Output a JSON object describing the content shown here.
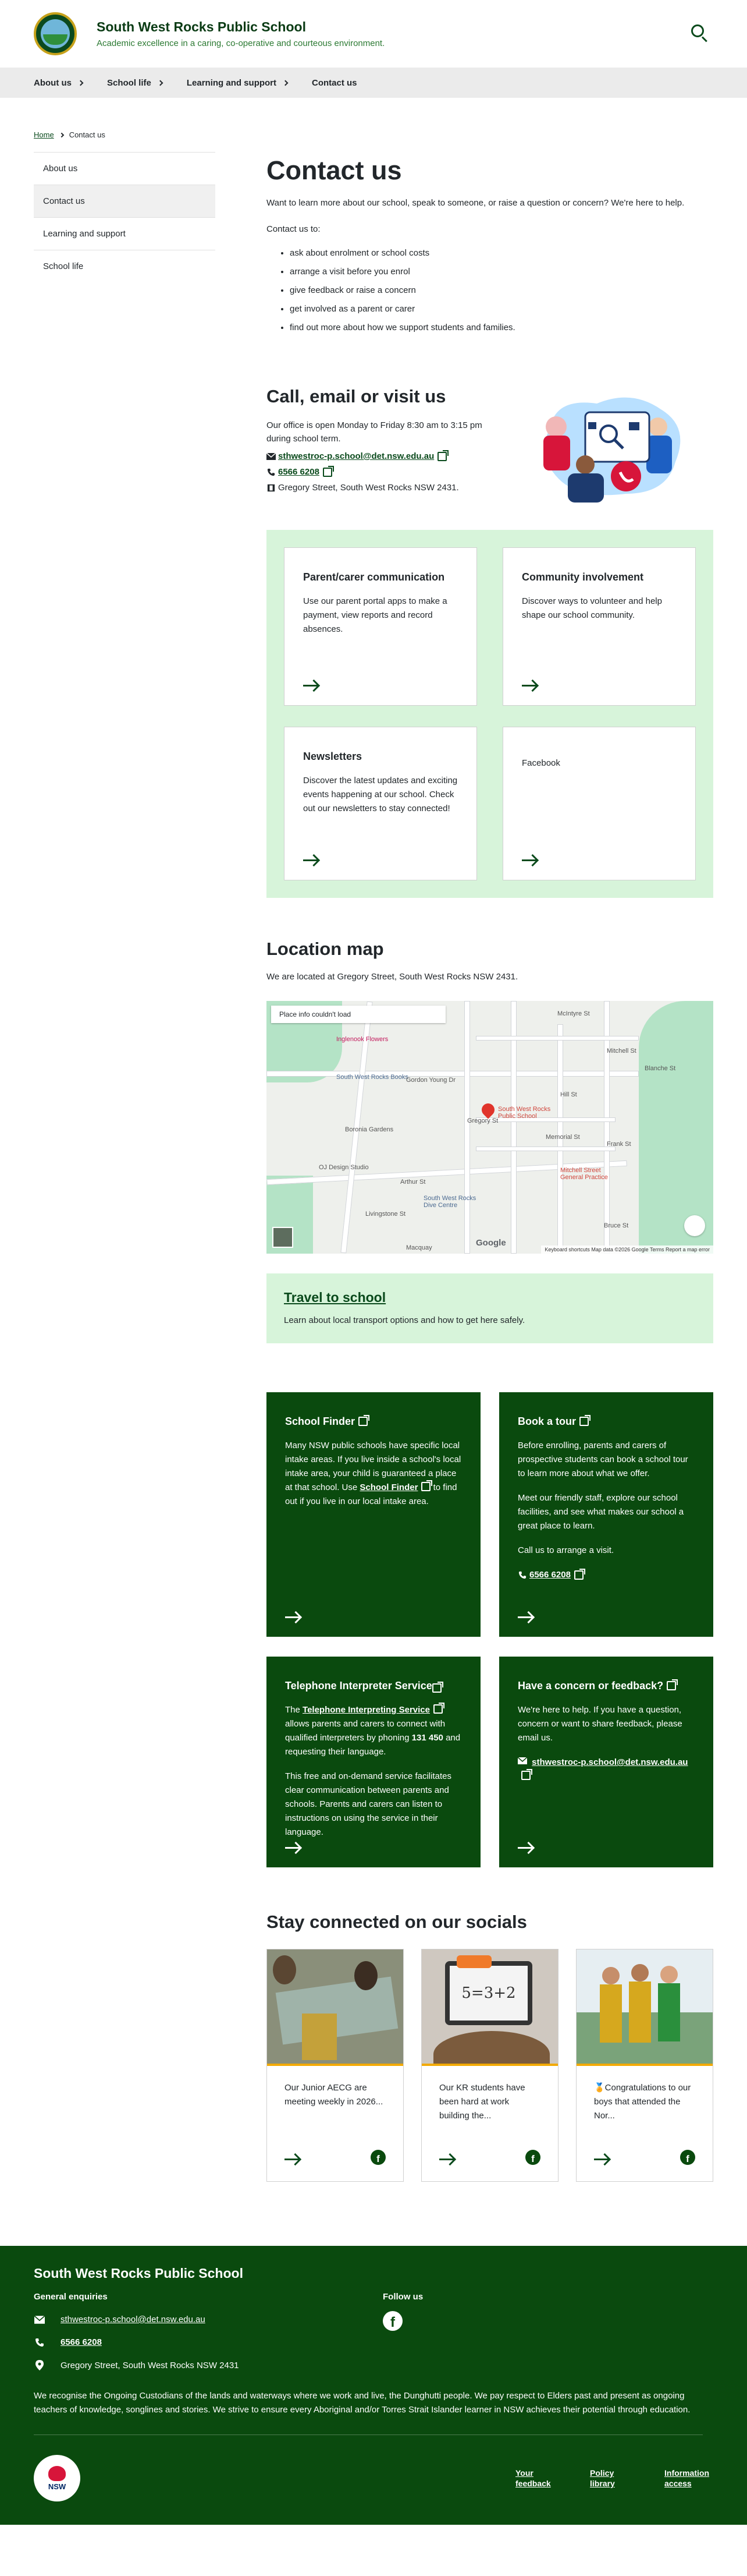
{
  "header": {
    "school_name": "South West Rocks Public School",
    "tagline": "Academic excellence in a caring, co-operative and courteous environment."
  },
  "nav": [
    "About us",
    "School life",
    "Learning and support",
    "Contact us"
  ],
  "breadcrumb": {
    "home": "Home",
    "current": "Contact us"
  },
  "sidebar": [
    "About us",
    "Contact us",
    "Learning and support",
    "School life"
  ],
  "main": {
    "title": "Contact us",
    "intro": "Want to learn more about our school, speak to someone, or raise a question or concern? We're here to help.",
    "list_intro": "Contact us to:",
    "bullets": [
      "ask about enrolment or school costs",
      "arrange a visit before you enrol",
      "give feedback or raise a concern",
      "get involved as a parent or carer",
      "find out more about how we support students and families."
    ]
  },
  "call": {
    "heading": "Call, email or visit us",
    "hours": "Our office is open Monday to Friday 8:30 am to 3:15 pm during school term.",
    "email": "sthwestroc-p.school@det.nsw.edu.au",
    "phone": "6566 6208",
    "address": "Gregory Street, South West Rocks NSW 2431."
  },
  "link_cards": [
    {
      "title": "Parent/carer communication",
      "body": "Use our parent portal apps to make a payment, view reports and record absences."
    },
    {
      "title": "Community involvement",
      "body": "Discover ways to volunteer and help shape our school community."
    },
    {
      "title": "Newsletters",
      "body": "Discover the latest updates and exciting events happening at our school. Check out our newsletters to stay connected!"
    },
    {
      "title": "Facebook",
      "body": ""
    }
  ],
  "location": {
    "heading": "Location map",
    "text": "We are located at Gregory Street, South West Rocks NSW 2431.",
    "map": {
      "note": "Place info couldn't load",
      "labels": [
        "Inglenook Flowers",
        "South West Rocks Books",
        "Gordon Young Dr",
        "Boronia Gardens",
        "OJ Design Studio",
        "South West Rocks Dive Centre",
        "Mitchell Street General Practice",
        "McIntyre St",
        "Mitchell St",
        "Gregory St",
        "Arthur St",
        "Hill St",
        "Blanche St",
        "Memorial St",
        "Frank St",
        "Bruce St",
        "Livingstone St",
        "Macquay"
      ],
      "school_pin": "South West Rocks Public School",
      "footer": "Keyboard shortcuts   Map data ©2026 Google   Terms   Report a map error",
      "logo": "Google"
    }
  },
  "travel": {
    "link": "Travel to school",
    "text": "Learn about local transport options and how to get here safely."
  },
  "dark_cards": {
    "finder": {
      "title": "School Finder",
      "body1": "Many NSW public schools have specific local intake areas. If you live inside a school's local intake area, your child is guaranteed a place at that school. Use",
      "link": "School Finder",
      "body2": "to find out if you live in our local intake area."
    },
    "tour": {
      "title": "Book a tour",
      "p1": "Before enrolling, parents and carers of prospective students can book a school tour to learn more about what we offer.",
      "p2": "Meet our friendly staff, explore our school facilities, and see what makes our school a great place to learn.",
      "p3": "Call us to arrange a visit.",
      "phone": "6566 6208"
    },
    "interpreter": {
      "title": "Telephone Interpreter Service",
      "pre": "The",
      "link": "Telephone Interpreting Service",
      "p1": "allows parents and carers to connect with qualified interpreters by phoning",
      "number": "131 450",
      "p1b": "and requesting their language.",
      "p2": "This free and on-demand service facilitates clear communication between parents and schools. Parents and carers can listen to instructions on using the service in their language."
    },
    "concern": {
      "title": "Have a concern or feedback?",
      "p1": "We're here to help. If you have a question, concern or want to share feedback, please email us.",
      "email": "sthwestroc-p.school@det.nsw.edu.au"
    }
  },
  "socials": {
    "heading": "Stay connected on our socials",
    "posts": [
      {
        "text": "Our Junior AECG are meeting weekly in 2026..."
      },
      {
        "text": "Our KR students have been hard at work building the...",
        "board": "5=3+2"
      },
      {
        "text": "🏅Congratulations to our boys that attended the Nor..."
      }
    ]
  },
  "footer": {
    "title": "South West Rocks Public School",
    "enquiries": "General enquiries",
    "email": "sthwestroc-p.school@det.nsw.edu.au",
    "phone": "6566 6208",
    "address": "Gregory Street, South West Rocks NSW 2431",
    "follow": "Follow us",
    "ack": "We recognise the Ongoing Custodians of the lands and waterways where we work and live, the Dunghutti people. We pay respect to Elders past and present as ongoing teachers of knowledge, songlines and stories. We strive to ensure every Aboriginal and/or Torres Strait Islander learner in NSW achieves their potential through education.",
    "nsw": "NSW",
    "links": [
      "Your feedback",
      "Policy library",
      "Information access"
    ]
  },
  "colors": {
    "brand_dark_green": "#0a4a0e",
    "panel_green": "#d7f4da",
    "accent_gold": "#f2a900",
    "pin_red": "#e0342b"
  }
}
